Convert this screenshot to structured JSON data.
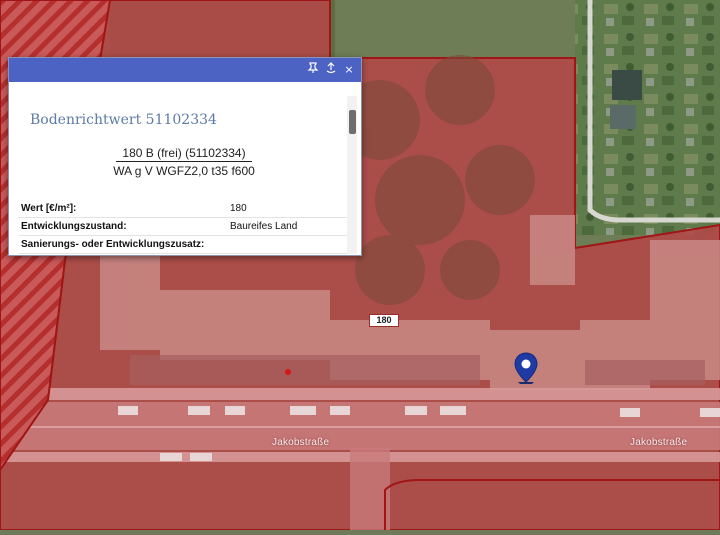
{
  "map": {
    "street_labels": [
      "Jakobstraße",
      "Jakobstraße"
    ],
    "value_badge": "180",
    "zone_color": "#c23b3b",
    "zone_border_color": "#a01515"
  },
  "popup": {
    "title_bar_color": "#4d63c4",
    "titlebar_icons": [
      "pin-icon",
      "detach-icon",
      "close-icon"
    ],
    "close_symbol": "×",
    "heading": "Bodenrichtwert 51102334",
    "fraction_numerator": "180 B (frei) (51102334)",
    "fraction_denominator": "WA g V WGFZ2,0 t35 f600",
    "rows": [
      {
        "key": "Wert [€/m²]:",
        "value": "180"
      },
      {
        "key": "Entwicklungszustand:",
        "value": "Baureifes Land"
      },
      {
        "key": "Sanierungs- oder Entwicklungszusatz:",
        "value": ""
      }
    ]
  }
}
